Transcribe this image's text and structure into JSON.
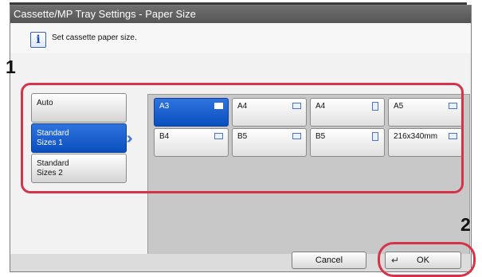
{
  "window": {
    "title": "Cassette/MP Tray Settings - Paper Size"
  },
  "message": {
    "icon": "info-icon",
    "text": "Set cassette paper size."
  },
  "callouts": {
    "one": "1",
    "two": "2"
  },
  "categories": [
    {
      "line1": "Auto",
      "line2": "",
      "selected": false
    },
    {
      "line1": "Standard",
      "line2": "Sizes 1",
      "selected": true
    },
    {
      "line1": "Standard",
      "line2": "Sizes 2",
      "selected": false
    }
  ],
  "sizes": [
    {
      "label": "A3",
      "orientation": "landscape",
      "selected": true
    },
    {
      "label": "A4",
      "orientation": "landscape",
      "selected": false
    },
    {
      "label": "A4",
      "orientation": "portrait",
      "selected": false
    },
    {
      "label": "A5",
      "orientation": "landscape",
      "selected": false
    },
    {
      "label": "B4",
      "orientation": "landscape",
      "selected": false
    },
    {
      "label": "B5",
      "orientation": "landscape",
      "selected": false
    },
    {
      "label": "B5",
      "orientation": "portrait",
      "selected": false
    },
    {
      "label": "216x340mm",
      "orientation": "landscape",
      "selected": false
    }
  ],
  "footer": {
    "cancel_label": "Cancel",
    "ok_label": "OK",
    "ok_icon": "enter-icon"
  },
  "colors": {
    "selected": "#0a4fbf",
    "callout_highlight": "#d6334a"
  }
}
